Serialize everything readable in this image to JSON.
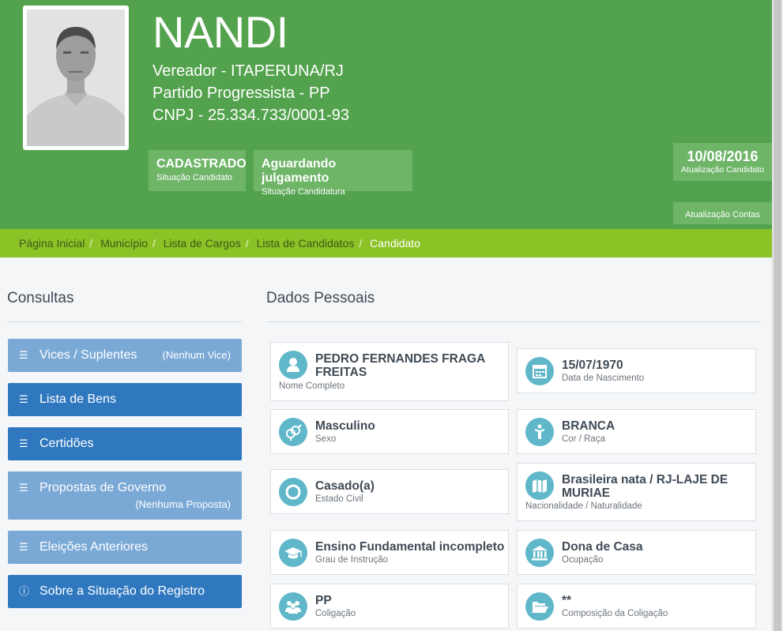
{
  "candidate": {
    "name": "NANDI",
    "office": "Vereador - ITAPERUNA/RJ",
    "party": "Partido Progressista - PP",
    "cnpj": "CNPJ - 25.334.733/0001-93",
    "status_candidate": {
      "value": "CADASTRADO",
      "label": "Situação Candidato"
    },
    "status_candidacy": {
      "value": "Aguardando julgamento",
      "label": "Situação Candidatura"
    },
    "update_candidate": {
      "date": "10/08/2016",
      "label": "Atualização Candidato"
    },
    "update_accounts": {
      "label": "Atualização Contas"
    }
  },
  "breadcrumb": [
    "Página Inicial",
    "Município",
    "Lista de Cargos",
    "Lista de Candidatos",
    "Candidato"
  ],
  "sidebar": {
    "title": "Consultas",
    "items": [
      {
        "label": "Vices / Suplentes",
        "extra": "(Nenhum Vice)",
        "icon": "list-icon"
      },
      {
        "label": "Lista de Bens",
        "extra": "",
        "icon": "list-icon"
      },
      {
        "label": "Certidões",
        "extra": "",
        "icon": "list-icon"
      },
      {
        "label": "Propostas de Governo",
        "extra": "(Nenhuma Proposta)",
        "icon": "list-icon"
      },
      {
        "label": "Eleições Anteriores",
        "extra": "",
        "icon": "list-icon"
      },
      {
        "label": "Sobre a Situação do Registro",
        "extra": "",
        "icon": "info-icon"
      }
    ]
  },
  "personal": {
    "title": "Dados Pessoais",
    "fields": [
      {
        "value": "PEDRO FERNANDES FRAGA FREITAS",
        "label": "Nome Completo",
        "icon": "user-icon"
      },
      {
        "value": "15/07/1970",
        "label": "Data de Nascimento",
        "icon": "calendar-icon"
      },
      {
        "value": "Masculino",
        "label": "Sexo",
        "icon": "gender-icon"
      },
      {
        "value": "BRANCA",
        "label": "Cor / Raça",
        "icon": "person-icon"
      },
      {
        "value": "Casado(a)",
        "label": "Estado Civil",
        "icon": "ring-icon"
      },
      {
        "value": "Brasileira nata / RJ-LAJE DE MURIAE",
        "label": "Nacionalidade / Naturalidade",
        "icon": "map-icon"
      },
      {
        "value": "Ensino Fundamental incompleto",
        "label": "Grau de Instrução",
        "icon": "graduation-cap-icon"
      },
      {
        "value": "Dona de Casa",
        "label": "Ocupação",
        "icon": "bank-icon"
      },
      {
        "value": "PP",
        "label": "Coligação",
        "icon": "group-icon"
      },
      {
        "value": "**",
        "label": "Composição da Coligação",
        "icon": "folder-open-icon"
      }
    ]
  },
  "colors": {
    "header": "#53a24d",
    "breadcrumb": "#8bc226",
    "button_dark": "#2f78bf",
    "button_light": "#7ba9d6",
    "icon": "#5fb7c9"
  }
}
